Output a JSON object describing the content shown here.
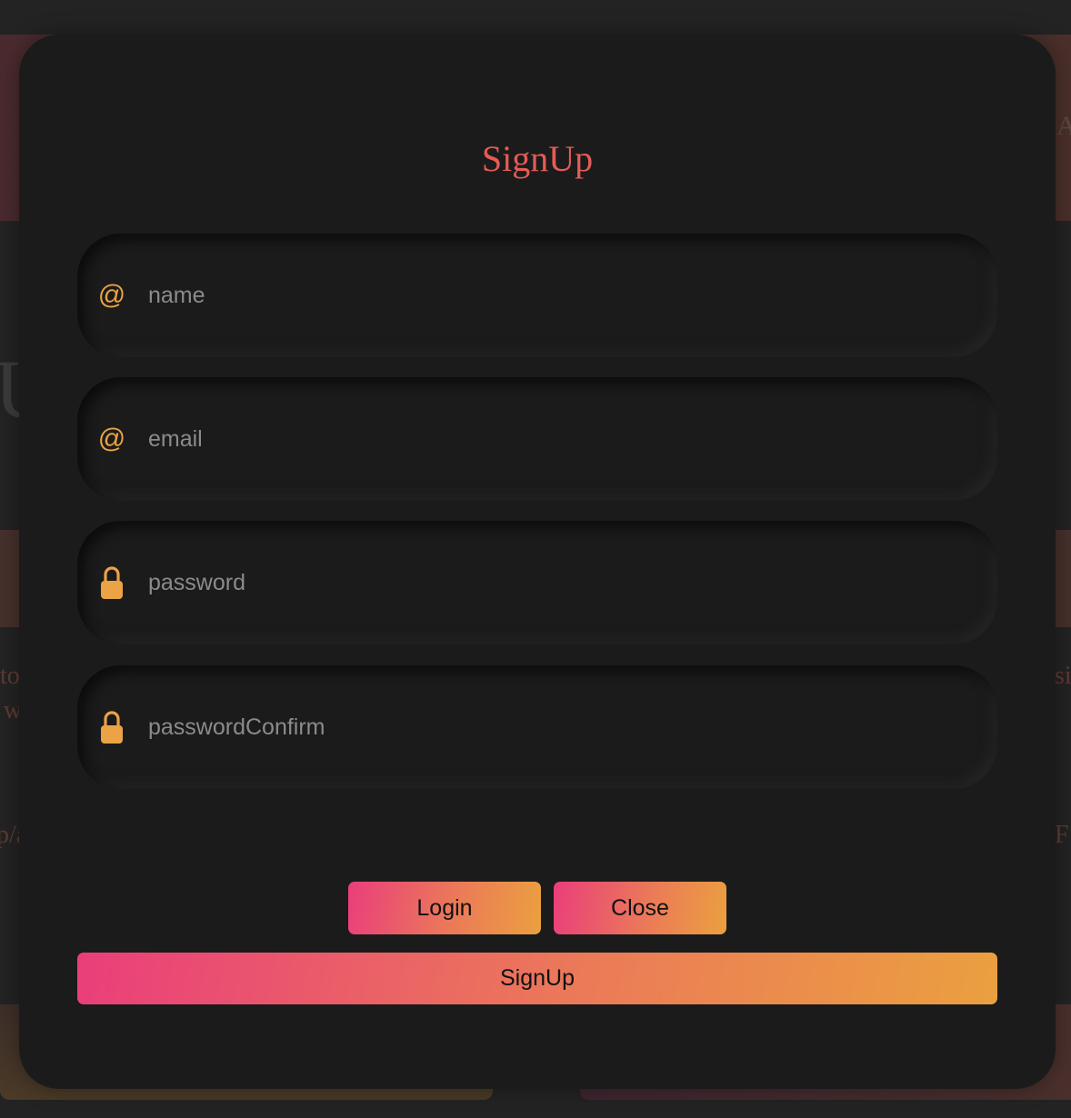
{
  "modal": {
    "title": "SignUp",
    "fields": [
      {
        "name": "name",
        "placeholder": "name",
        "icon": "at-icon"
      },
      {
        "name": "email",
        "placeholder": "email",
        "icon": "at-icon"
      },
      {
        "name": "password",
        "placeholder": "password",
        "icon": "lock-icon"
      },
      {
        "name": "passwordConfirm",
        "placeholder": "passwordConfirm",
        "icon": "lock-icon"
      }
    ],
    "buttons": {
      "login": "Login",
      "close": "Close",
      "signup": "SignUp"
    }
  },
  "colors": {
    "title": "#e45b57",
    "icon": "#eba345",
    "gradient_start": "#ea3e7b",
    "gradient_end": "#eba03f",
    "modal_bg": "#1b1b1b"
  },
  "background_page": {
    "heading_fragment": "Us",
    "side_letter": "A",
    "text_fragments": [
      "to",
      "w",
      "si",
      "p/a",
      "F"
    ]
  }
}
